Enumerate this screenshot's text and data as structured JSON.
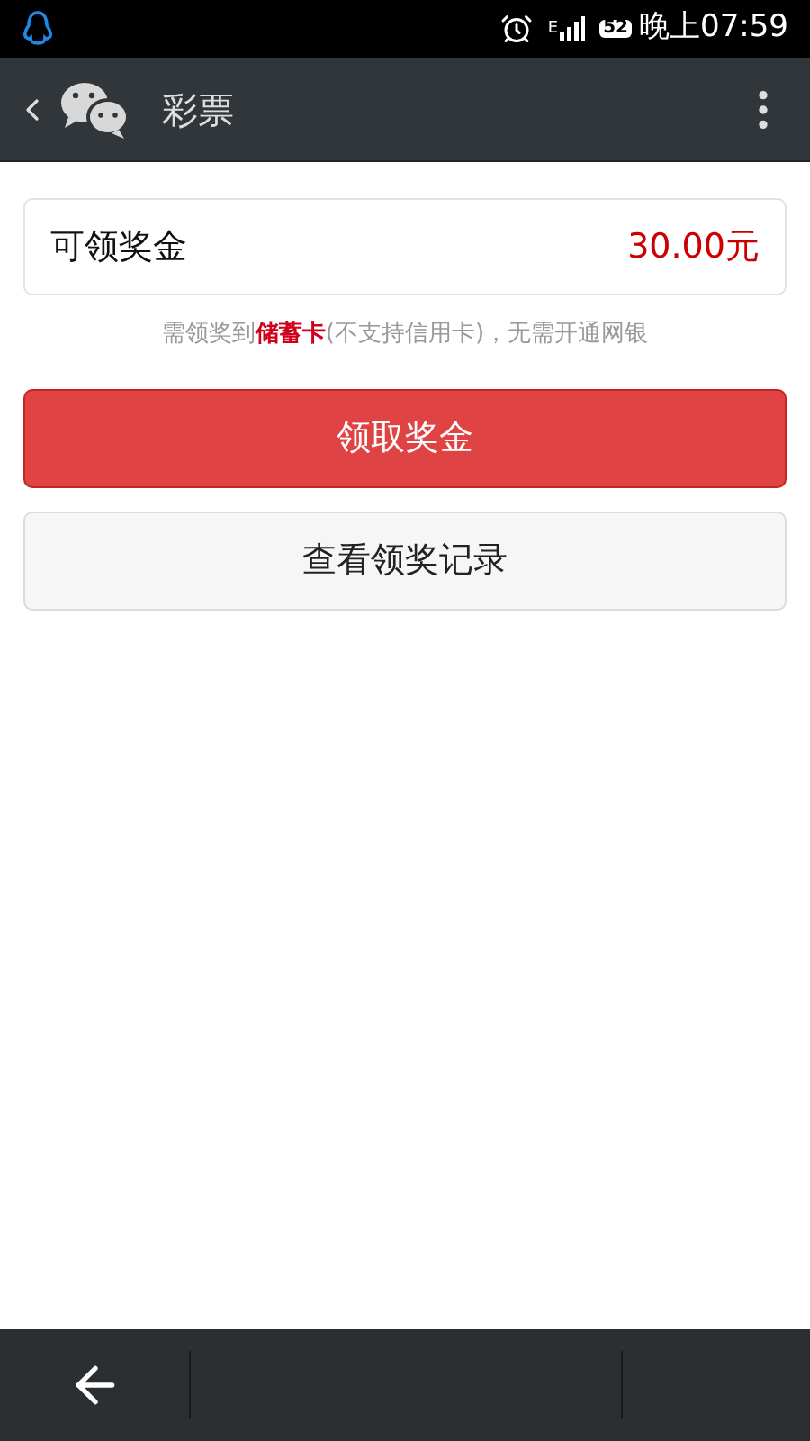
{
  "status_bar": {
    "time": "晚上07:59",
    "battery": "52",
    "network": "E"
  },
  "header": {
    "title": "彩票"
  },
  "prize": {
    "label": "可领奖金",
    "amount": "30.00元"
  },
  "notice": "需领奖到**储蓄卡**(不支持信用卡)，无需开通网银",
  "buttons": [
    {
      "label": "领取奖金",
      "kind": "primary"
    },
    {
      "label": "查看领奖记录",
      "kind": "secondary"
    }
  ]
}
